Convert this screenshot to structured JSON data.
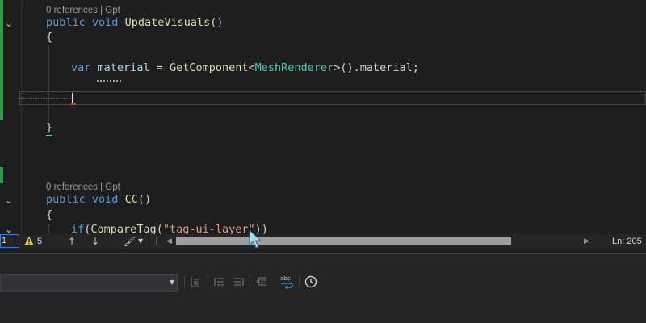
{
  "editor": {
    "codelens_1": "0 references | Gpt",
    "method_1": {
      "kw_public": "public",
      "kw_void": "void",
      "name": "UpdateVisuals",
      "parens": "()"
    },
    "open_brace_1": "{",
    "statement": {
      "kw_var": "var",
      "ident": "material",
      "eq": " = ",
      "call": "GetComponent",
      "lt": "<",
      "type": "MeshRenderer",
      "rest": ">().material;"
    },
    "close_brace_1": "}",
    "codelens_2": "0 references | Gpt",
    "method_2": {
      "kw_public": "public",
      "kw_void": "void",
      "name": "CC",
      "parens": "()"
    },
    "open_brace_2": "{",
    "if_line": {
      "kw_if": "if",
      "open": "(",
      "call": "CompareTag",
      "paren": "(",
      "str": "\"tag-ui-layer\"",
      "close": "))"
    }
  },
  "statusbar": {
    "zoom": "1",
    "warnings": "5",
    "up_arrow": "↑",
    "down_arrow": "↓",
    "line_label": "Ln: 205"
  },
  "toolbar": {
    "dropdown_value": ""
  },
  "colors": {
    "background": "#1e1e1e",
    "keyword": "#569cd6",
    "function": "#dcdcaa",
    "type": "#4ec9b0",
    "string": "#d69d85",
    "change_bar": "#2ea043"
  }
}
